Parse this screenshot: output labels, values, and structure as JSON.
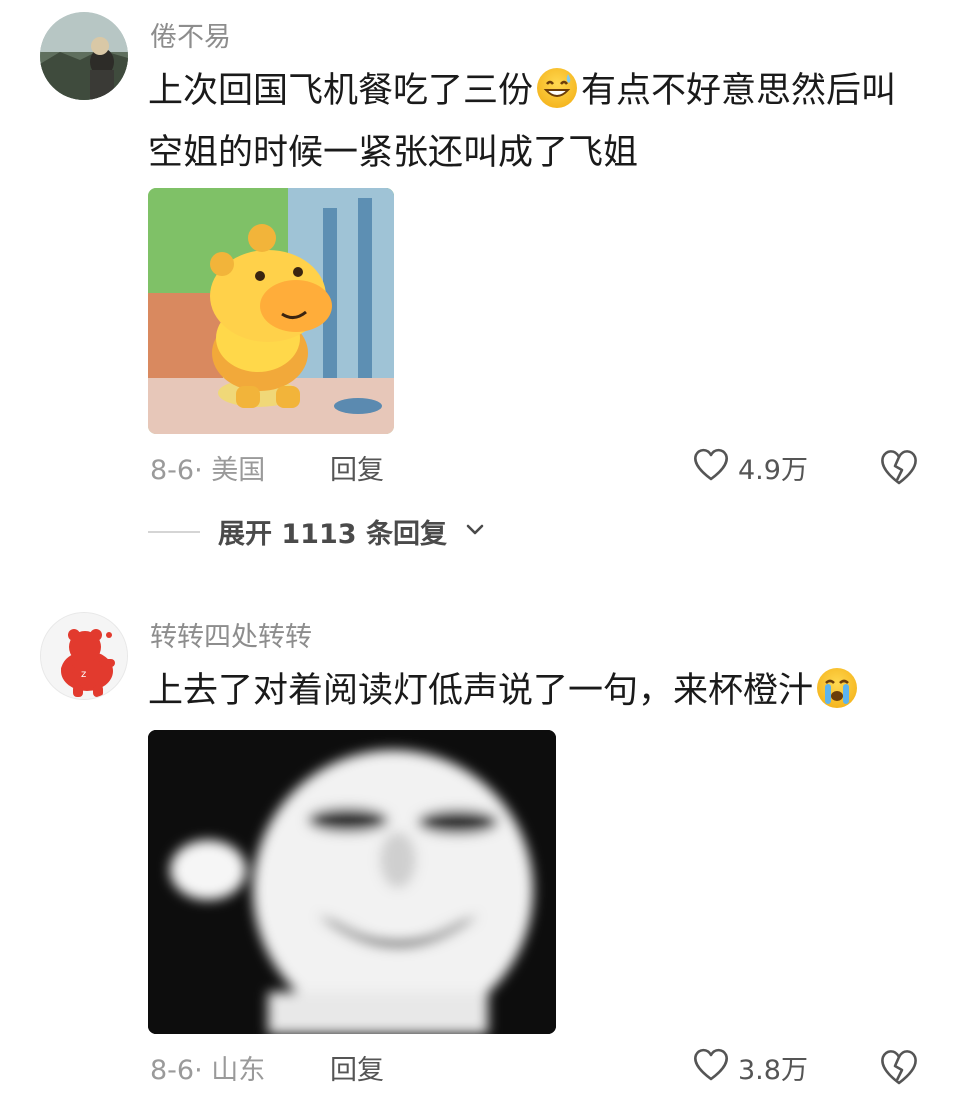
{
  "comments": [
    {
      "username": "倦不易",
      "text_parts": [
        "上次回国飞机餐吃了三份",
        "有点不好意思然后叫空姐的时候一紧张还叫成了飞姐"
      ],
      "emoji": "grinning-sweat-emoji",
      "meta": "8-6· 美国",
      "reply_label": "回复",
      "likes": "4.9万",
      "expand_label": "展开 1113 条回复"
    },
    {
      "username": "转转四处转转",
      "text_parts": [
        "上去了对着阅读灯低声说了一句，来杯橙汁"
      ],
      "emoji": "crying-face-emoji",
      "meta": "8-6· 山东",
      "reply_label": "回复",
      "likes": "3.8万"
    }
  ],
  "icons": {
    "like": "heart-outline-icon",
    "dislike": "broken-heart-icon",
    "expand": "chevron-down-icon"
  }
}
